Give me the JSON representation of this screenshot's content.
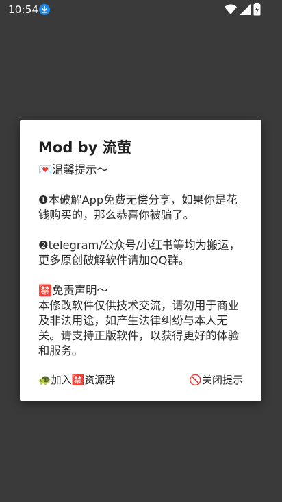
{
  "status_bar": {
    "time": "10:54"
  },
  "dialog": {
    "title": "Mod by 流萤",
    "tip_heading": "💌温馨提示～",
    "paragraphs": [
      "❶本破解App免费无偿分享，如果你是花钱购买的，那么恭喜你被骗了。",
      "❷telegram/公众号/小红书等均为搬运，更多原创破解软件请加QQ群。",
      "🈲免责声明～",
      "本修改软件仅供技术交流，请勿用于商业及非法用途，如产生法律纠纷与本人无关。请支持正版软件，以获得更好的体验和服务。"
    ],
    "join_button": "🐢加入🈲资源群",
    "close_button": "🚫关闭提示"
  },
  "colors": {
    "backdrop": "#3a3a3a",
    "dialog_bg": "#ffffff",
    "text": "#2b2b2b"
  },
  "icons": [
    "download-icon",
    "wifi-icon",
    "signal-icon",
    "battery-icon"
  ]
}
